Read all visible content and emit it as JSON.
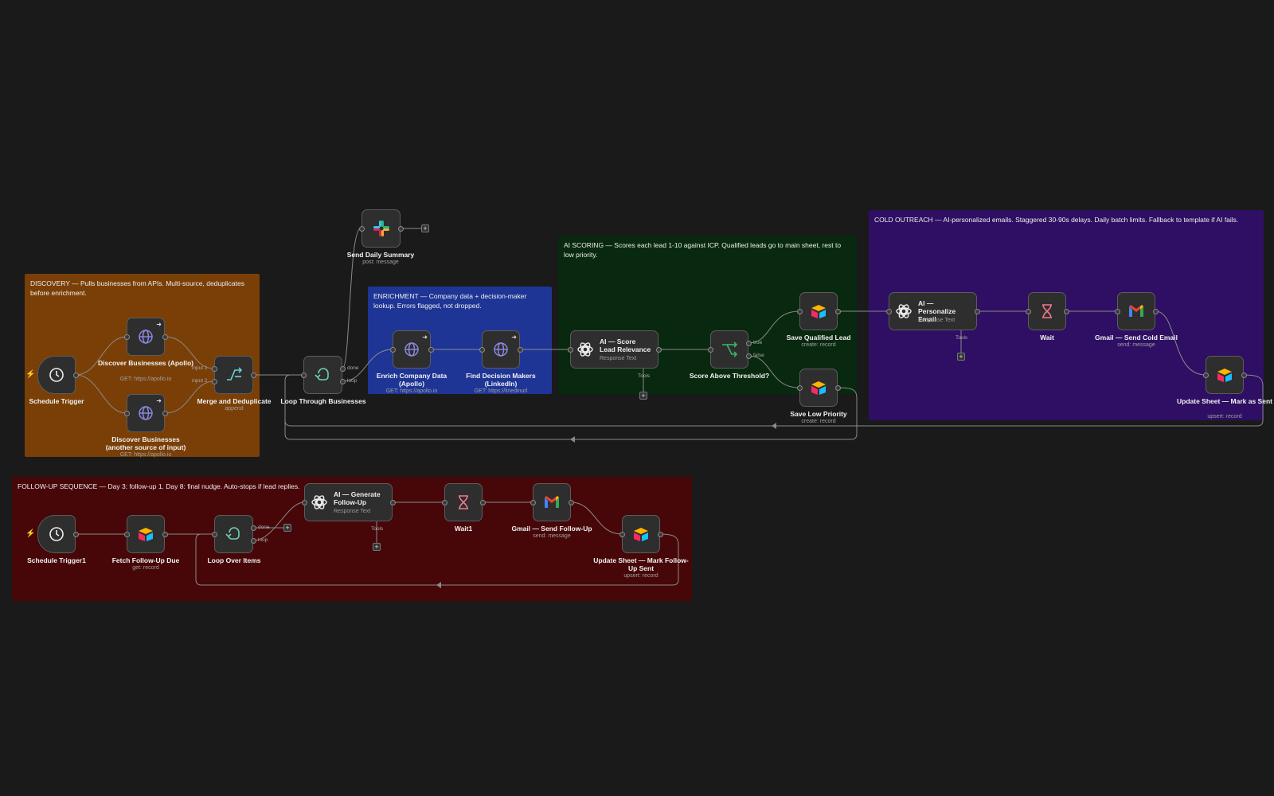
{
  "groups": {
    "discovery": {
      "note": "DISCOVERY — Pulls businesses from APIs. Multi-source, deduplicates before enrichment.",
      "color": "#7a3f07"
    },
    "enrichment": {
      "note": "ENRICHMENT — Company data + decision-maker lookup. Errors flagged, not dropped.",
      "color": "#1e3596"
    },
    "scoring": {
      "note": "AI SCORING — Scores each lead 1-10 against ICP. Qualified leads go to main sheet, rest to low priority.",
      "color": "#08290f"
    },
    "outreach": {
      "note": "COLD OUTREACH — AI-personalized emails. Staggered 30-90s delays. Daily batch limits. Fallback to template if AI fails.",
      "color": "#2e0f63"
    },
    "followup": {
      "note": "FOLLOW-UP SEQUENCE — Day 3: follow-up 1. Day 8: final nudge. Auto-stops if lead replies.",
      "color": "#470708"
    }
  },
  "nodes": {
    "schedule_trigger": {
      "label": "Schedule Trigger",
      "icon": "clock-icon"
    },
    "discover_apollo": {
      "label": "Discover Businesses (Apollo)",
      "sub": "GET: https://apollo.io",
      "icon": "globe-icon"
    },
    "discover_other": {
      "label": "Discover Businesses (another source of input)",
      "sub": "GET: https://apollo.io",
      "icon": "globe-icon"
    },
    "merge": {
      "label": "Merge and Deduplicate",
      "sub": "append",
      "icon": "merge-icon",
      "in1": "input 1",
      "in2": "input 2"
    },
    "loop": {
      "label": "Loop Through Businesses",
      "icon": "loop-icon",
      "done": "done",
      "loop": "loop"
    },
    "slack": {
      "label": "Send Daily Summary",
      "sub": "post: message",
      "icon": "slack-icon"
    },
    "enrich": {
      "label": "Enrich Company Data (Apollo)",
      "sub": "GET: https://apollo.io",
      "icon": "globe-icon"
    },
    "decision": {
      "label": "Find Decision Makers (LinkedIn)",
      "sub": "GET: https://linedinurl",
      "icon": "globe-icon"
    },
    "score": {
      "title": "AI — Score Lead Relevance",
      "sub": "Response Text",
      "tools": "Tools",
      "icon": "openai-icon"
    },
    "threshold": {
      "label": "Score Above Threshold?",
      "icon": "if-icon",
      "true": "true",
      "false": "false"
    },
    "save_qualified": {
      "label": "Save Qualified Lead",
      "sub": "create: record",
      "icon": "airtable-icon"
    },
    "save_low": {
      "label": "Save Low Priority",
      "sub": "create: record",
      "icon": "airtable-icon"
    },
    "personalize": {
      "title": "AI — Personalize Email",
      "sub": "Response Text",
      "tools": "Tools",
      "icon": "openai-icon"
    },
    "wait": {
      "label": "Wait",
      "icon": "hourglass-icon"
    },
    "gmail_cold": {
      "label": "Gmail — Send Cold Email",
      "sub": "send: message",
      "icon": "gmail-icon"
    },
    "update_sent": {
      "label": "Update Sheet — Mark as Sent",
      "sub": "upsert: record",
      "icon": "airtable-icon"
    },
    "schedule_trigger1": {
      "label": "Schedule Trigger1",
      "icon": "clock-icon"
    },
    "fetch_followup": {
      "label": "Fetch Follow-Up Due",
      "sub": "get: record",
      "icon": "airtable-icon"
    },
    "loop_items": {
      "label": "Loop Over Items",
      "icon": "loop-icon",
      "done": "done",
      "loop": "loop"
    },
    "gen_followup": {
      "title": "AI — Generate Follow-Up",
      "sub": "Response Text",
      "tools": "Tools",
      "icon": "openai-icon"
    },
    "wait1": {
      "label": "Wait1",
      "icon": "hourglass-icon"
    },
    "gmail_followup": {
      "label": "Gmail — Send Follow-Up",
      "sub": "send: message",
      "icon": "gmail-icon"
    },
    "update_followup": {
      "label": "Update Sheet — Mark Follow-Up Sent",
      "sub": "upsert: record",
      "icon": "airtable-icon"
    }
  },
  "colors": {
    "canvas": "#1a1a1a",
    "node": "#2e2e2e",
    "wire": "#8a8a8a",
    "trigger_bolt": "#e8642c"
  }
}
